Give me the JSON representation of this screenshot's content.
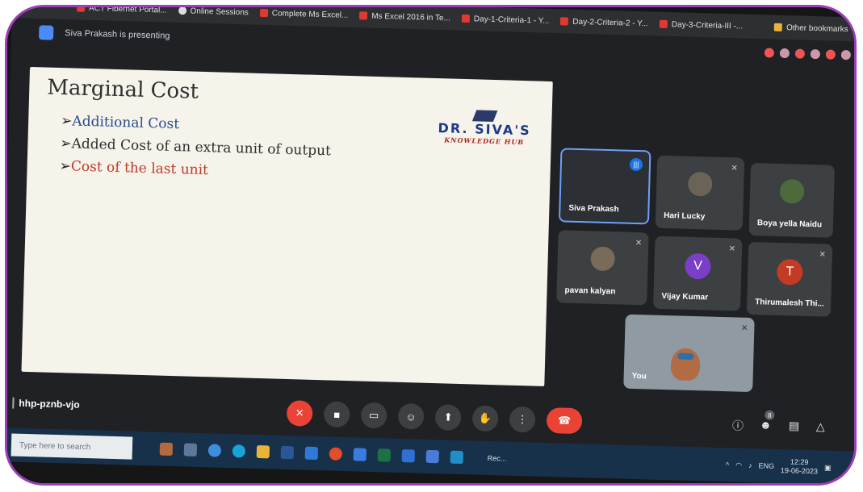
{
  "browser": {
    "bookmarks": [
      {
        "label": "ACT Fibernet Portal..."
      },
      {
        "label": "Online Sessions"
      },
      {
        "label": "Complete Ms Excel..."
      },
      {
        "label": "Ms Excel 2016 in Te..."
      },
      {
        "label": "Day-1-Criteria-1 - Y..."
      },
      {
        "label": "Day-2-Criteria-2 - Y..."
      },
      {
        "label": "Day-3-Criteria-III -..."
      }
    ],
    "other_bookmarks": "Other bookmarks"
  },
  "meet": {
    "presenting_text": "Siva Prakash is presenting",
    "meeting_code": "hhp-pznb-vjo",
    "participant_count": "8"
  },
  "slide": {
    "title": "Marginal Cost",
    "bullets": [
      "Additional Cost",
      "Added Cost of an extra unit of output",
      "Cost of the last unit"
    ],
    "brand_name": "DR. SIVA'S",
    "brand_sub": "KNOWLEDGE HUB"
  },
  "participants": [
    {
      "name": "Siva Prakash"
    },
    {
      "name": "Hari Lucky"
    },
    {
      "name": "Boya yella Naidu"
    },
    {
      "name": "pavan kalyan"
    },
    {
      "name": "Vijay Kumar",
      "initial": "V",
      "color": "#7b3ec7"
    },
    {
      "name": "Thirumalesh Thi...",
      "initial": "T",
      "color": "#c23b22"
    },
    {
      "name": "You"
    }
  ],
  "taskbar": {
    "search_placeholder": "Type here to search",
    "rec_label": "Rec...",
    "lang": "ENG",
    "time": "12:29",
    "date": "19-06-2023"
  },
  "colors": {
    "accent": "#1a73e8",
    "end_call": "#ea4335",
    "frame_border": "#9b3fb6"
  }
}
